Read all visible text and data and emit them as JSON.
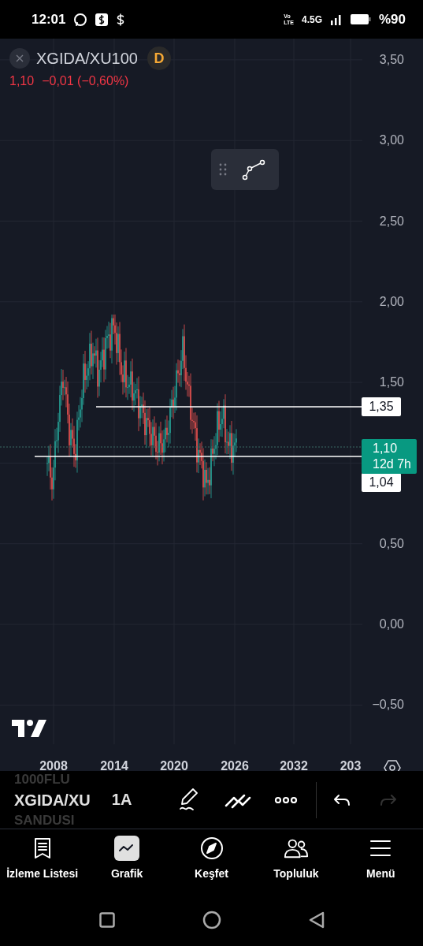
{
  "status_bar": {
    "time": "12:01",
    "volte": [
      "Vo",
      "LTE"
    ],
    "network": "4.5G",
    "battery": "%90"
  },
  "symbol": {
    "name": "XGIDA/XU100",
    "interval_badge": "D",
    "price": "1,10",
    "change": "−0,01 (−0,60%)"
  },
  "price_axis": [
    "3,50",
    "3,00",
    "2,50",
    "2,00",
    "1,50",
    "0,50",
    "0,00",
    "−0,50"
  ],
  "horizontal_lines": [
    {
      "label": "1,35"
    },
    {
      "label": "1,04"
    }
  ],
  "last_price": {
    "price": "1,10",
    "countdown": "12d 7h"
  },
  "time_axis": [
    "2008",
    "2014",
    "2020",
    "2026",
    "2032",
    "203"
  ],
  "toolbar": {
    "symbol_above": "1000FLU",
    "symbol": "XGIDA/XU",
    "symbol_below": "SANDUSI",
    "interval": "1A",
    "redo_disabled": true
  },
  "nav": [
    {
      "label": "İzleme Listesi",
      "selected": false
    },
    {
      "label": "Grafik",
      "selected": true
    },
    {
      "label": "Keşfet",
      "selected": false
    },
    {
      "label": "Topluluk",
      "selected": false
    },
    {
      "label": "Menü",
      "selected": false
    }
  ]
}
